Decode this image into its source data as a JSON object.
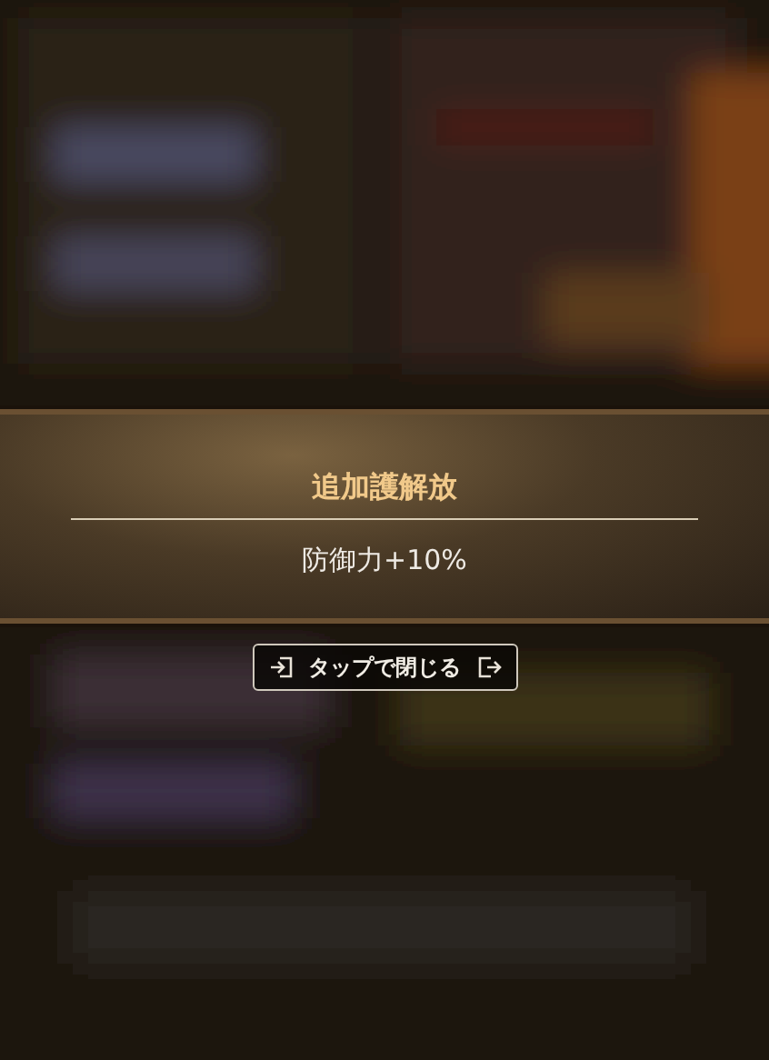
{
  "popup": {
    "title": "追加護解放",
    "effect": "防御力+10%"
  },
  "close_button": {
    "label": "タップで閉じる"
  }
}
